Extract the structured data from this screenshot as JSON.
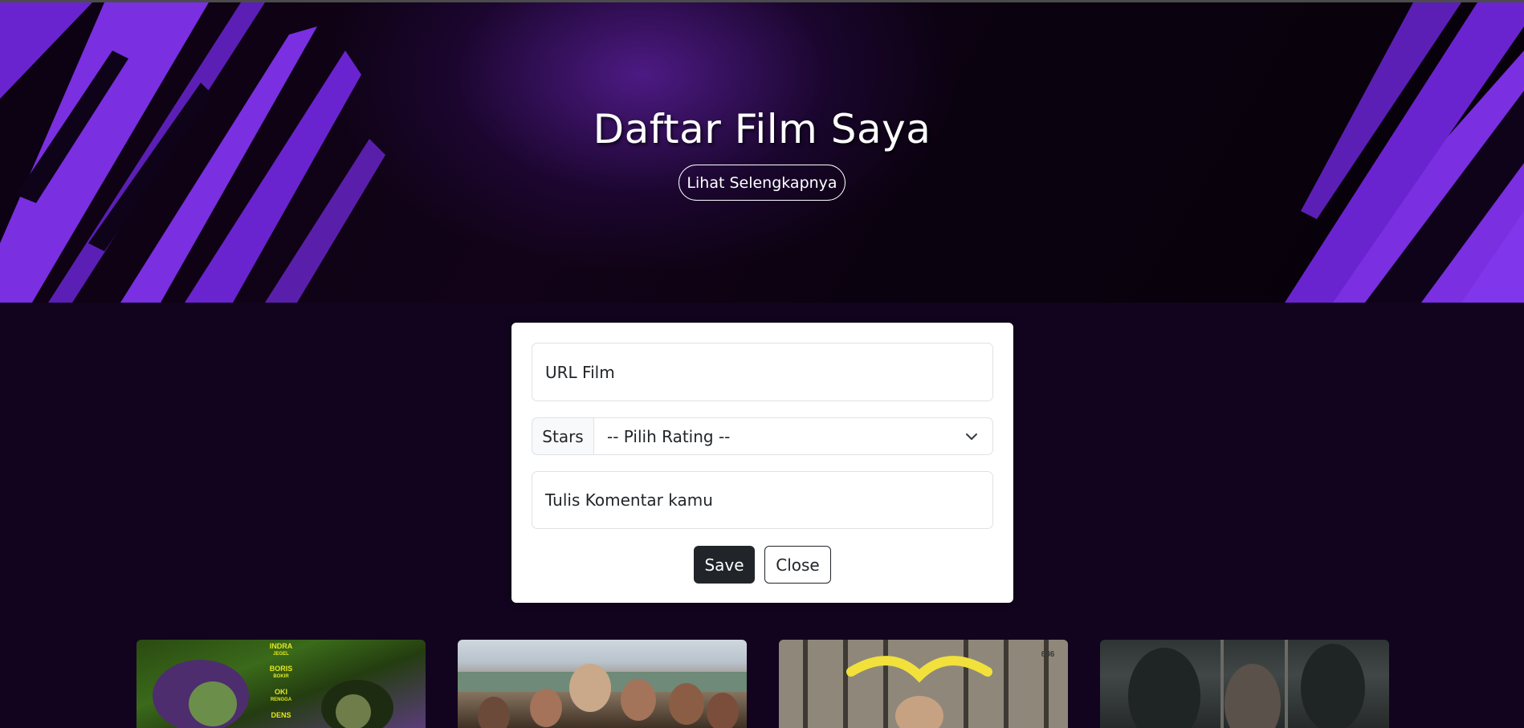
{
  "hero": {
    "title": "Daftar Film Saya",
    "button_label": "Lihat Selengkapnya"
  },
  "form": {
    "url_placeholder": "URL Film",
    "rating_addon_label": "Stars",
    "rating_selected": "-- Pilih Rating --",
    "comment_placeholder": "Tulis Komentar kamu",
    "save_label": "Save",
    "close_label": "Close"
  },
  "posters": [
    {
      "credits": [
        "INDRA",
        "JEGEL",
        "BORIS",
        "BOKIR",
        "OKI",
        "RENGGA",
        "DENS"
      ]
    },
    {
      "credits": []
    },
    {
      "credits": [
        "686"
      ]
    },
    {
      "credits": []
    }
  ],
  "colors": {
    "background": "#12041f",
    "accent_purple": "#7a2fe0",
    "button_dark": "#212529"
  }
}
